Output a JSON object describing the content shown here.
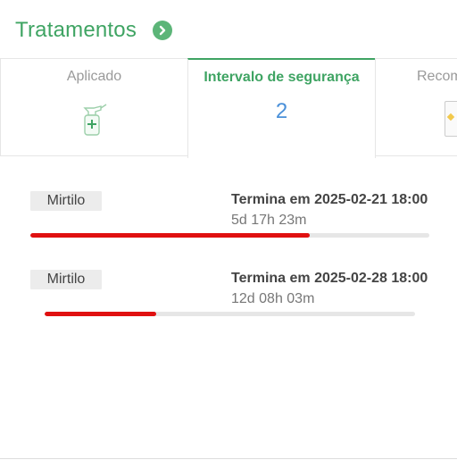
{
  "header": {
    "title": "Tratamentos",
    "go_icon": "chevron-right-circle-icon"
  },
  "tabs": [
    {
      "label": "Aplicado",
      "icon": "spray-bottle-icon",
      "active": false
    },
    {
      "label": "Intervalo de segurança",
      "value": "2",
      "active": true
    },
    {
      "label": "Recom",
      "icon": "document-icon",
      "active": false
    }
  ],
  "items": [
    {
      "crop": "Mirtilo",
      "end": "Termina em 2025-02-21 18:00",
      "remaining": "5d 17h 23m",
      "progress": 0.7
    },
    {
      "crop": "Mirtilo",
      "end": "Termina em 2025-02-28 18:00",
      "remaining": "12d 08h 03m",
      "progress": 0.3
    }
  ],
  "colors": {
    "accent": "#3fa463",
    "progress": "#e01010",
    "value": "#4a90d9"
  }
}
